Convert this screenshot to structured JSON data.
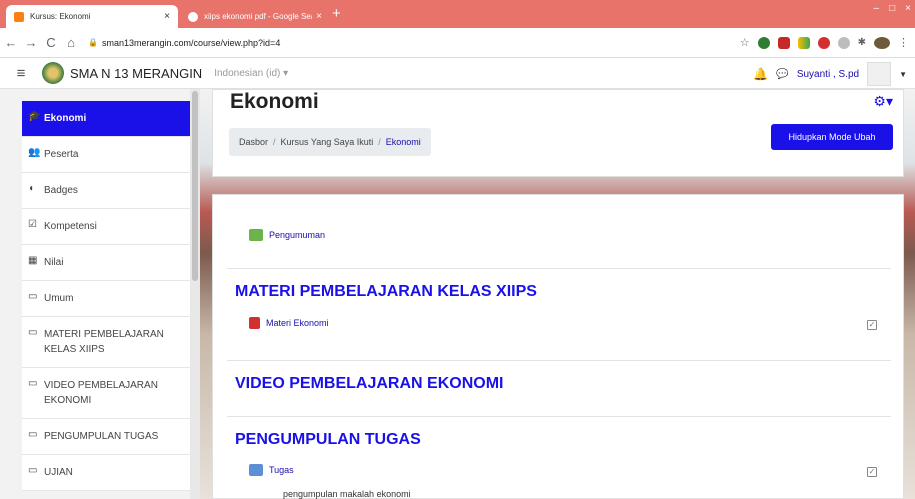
{
  "browser": {
    "tabs": [
      {
        "title": "Kursus: Ekonomi",
        "close": "×"
      },
      {
        "title": "xiips ekonomi pdf - Google Sear",
        "close": "×"
      }
    ],
    "newtab": "+",
    "window_controls": [
      "–",
      "□",
      "×"
    ],
    "nav": {
      "back": "←",
      "forward": "→",
      "reload": "C",
      "home": "⌂"
    },
    "url": "sman13merangin.com/course/view.php?id=4"
  },
  "navbar": {
    "site_name": "SMA N 13 MERANGIN",
    "language": "Indonesian (id) ▾",
    "user_name": "Suyanti , S.pd"
  },
  "sidebar": {
    "items": [
      {
        "icon": "🎓",
        "label": "Ekonomi"
      },
      {
        "icon": "👥",
        "label": "Peserta"
      },
      {
        "icon": "◖",
        "label": "Badges"
      },
      {
        "icon": "☑",
        "label": "Kompetensi"
      },
      {
        "icon": "▦",
        "label": "Nilai"
      },
      {
        "icon": "▭",
        "label": "Umum"
      },
      {
        "icon": "▭",
        "label": "MATERI PEMBELAJARAN KELAS XIIPS"
      },
      {
        "icon": "▭",
        "label": "VIDEO PEMBELAJARAN EKONOMI"
      },
      {
        "icon": "▭",
        "label": "PENGUMPULAN TUGAS"
      },
      {
        "icon": "▭",
        "label": "UJIAN"
      }
    ]
  },
  "header": {
    "title": "Ekonomi",
    "breadcrumb": [
      "Dasbor",
      "Kursus Yang Saya Ikuti",
      "Ekonomi"
    ],
    "edit_button": "Hidupkan Mode Ubah"
  },
  "content": {
    "announcement": "Pengumuman",
    "sections": [
      {
        "title": "MATERI PEMBELAJARAN KELAS XIIPS",
        "activity": "Materi Ekonomi"
      },
      {
        "title": "VIDEO PEMBELAJARAN EKONOMI"
      },
      {
        "title": "PENGUMPULAN TUGAS",
        "activity": "Tugas",
        "description": "pengumpulan makalah ekonomi"
      }
    ]
  },
  "colors": {
    "accent": "#1a11e8",
    "tabbar": "#e8736b"
  }
}
